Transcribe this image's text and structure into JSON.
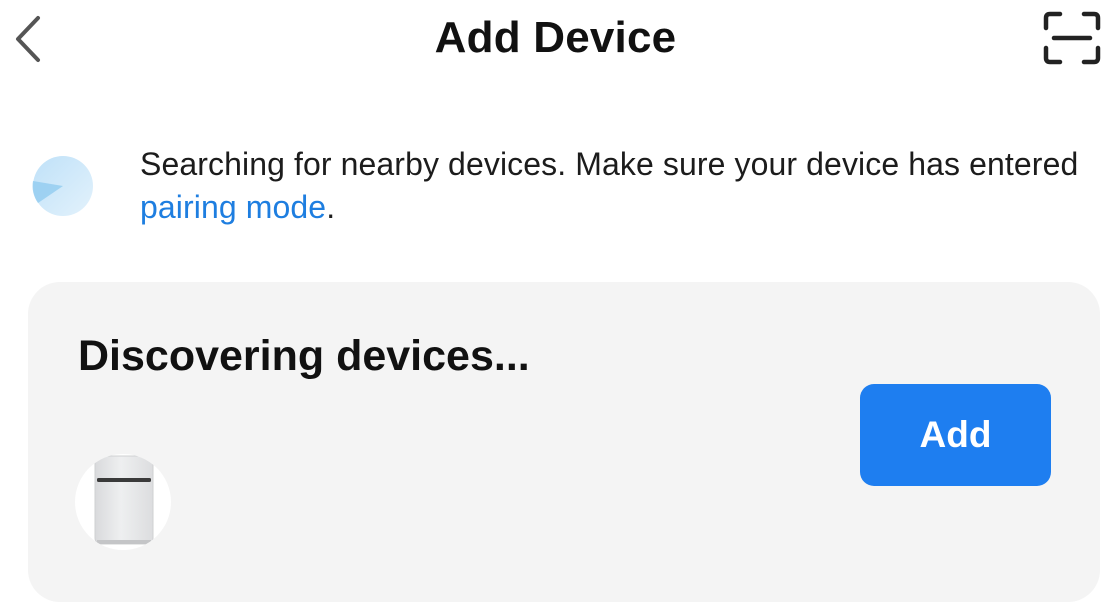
{
  "header": {
    "title": "Add Device",
    "back_icon": "chevron-left-icon",
    "scan_icon": "scan-icon"
  },
  "search": {
    "status_prefix": "Searching for nearby devices. Make sure your device has entered ",
    "link_text": "pairing mode",
    "status_suffix": ".",
    "spinner_icon": "loading-spinner-icon"
  },
  "discovery": {
    "title": "Discovering devices...",
    "add_label": "Add",
    "device_icon": "air-purifier-icon"
  },
  "colors": {
    "accent": "#1e7ef0",
    "link": "#1e7ee0",
    "card_background": "#f4f4f4",
    "text": "#111111"
  }
}
